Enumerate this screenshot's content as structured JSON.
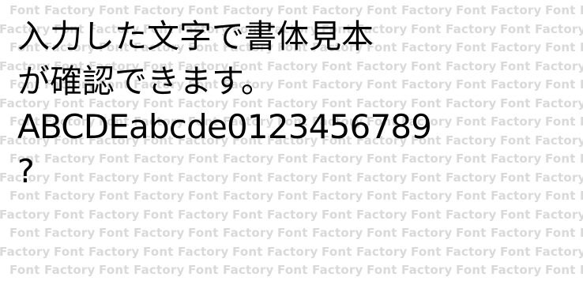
{
  "watermark": {
    "text": "Font Factory"
  },
  "sample": {
    "lines": [
      "入力した文字で書体見本",
      "が確認できます。",
      "ABCDEabcde0123456789",
      "?"
    ]
  },
  "colors": {
    "background": "#ffffff",
    "text": "#000000",
    "watermark": "#d9d9d9"
  }
}
